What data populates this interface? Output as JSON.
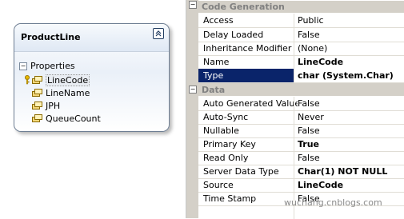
{
  "entity": {
    "title": "ProductLine",
    "section_label": "Properties",
    "properties": [
      {
        "label": "LineCode",
        "is_key": true,
        "selected": true
      },
      {
        "label": "LineName",
        "is_key": false,
        "selected": false
      },
      {
        "label": "JPH",
        "is_key": false,
        "selected": false
      },
      {
        "label": "QueueCount",
        "is_key": false,
        "selected": false
      }
    ]
  },
  "grid": {
    "categories": [
      {
        "label": "Code Generation",
        "rows": [
          {
            "name": "Access",
            "value": "Public",
            "bold": false
          },
          {
            "name": "Delay Loaded",
            "value": "False",
            "bold": false
          },
          {
            "name": "Inheritance Modifier",
            "value": "(None)",
            "bold": false
          },
          {
            "name": "Name",
            "value": "LineCode",
            "bold": true
          },
          {
            "name": "Type",
            "value": "char (System.Char)",
            "bold": true,
            "selected": true
          }
        ]
      },
      {
        "label": "Data",
        "rows": [
          {
            "name": "Auto Generated Value",
            "value": "False",
            "bold": false
          },
          {
            "name": "Auto-Sync",
            "value": "Never",
            "bold": false
          },
          {
            "name": "Nullable",
            "value": "False",
            "bold": false
          },
          {
            "name": "Primary Key",
            "value": "True",
            "bold": true
          },
          {
            "name": "Read Only",
            "value": "False",
            "bold": false
          },
          {
            "name": "Server Data Type",
            "value": "Char(1) NOT NULL",
            "bold": true
          },
          {
            "name": "Source",
            "value": "LineCode",
            "bold": true
          },
          {
            "name": "Time Stamp",
            "value": "False",
            "bold": false
          }
        ]
      }
    ]
  },
  "watermark": "wuchang.cnblogs.com",
  "colors": {
    "selection": "#0a246a",
    "category_bg": "#d4d0c8",
    "grid_line": "#e0ddd5"
  }
}
